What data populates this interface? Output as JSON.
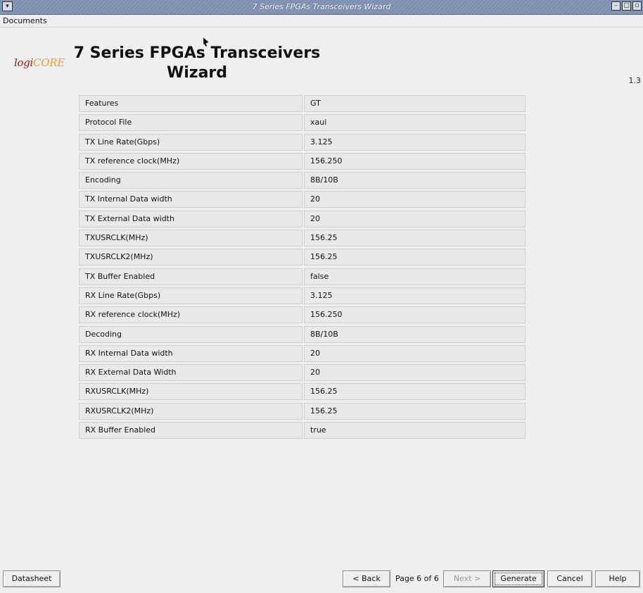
{
  "window": {
    "title": "7 Series FPGAs Transceivers Wizard",
    "menu": [
      "Documents"
    ]
  },
  "header": {
    "logo": {
      "text_prefix": "logi",
      "text_core": "CORE"
    },
    "title": "7 Series FPGAs Transceivers Wizard",
    "version": "1.3"
  },
  "summary_table": [
    {
      "label": "Features",
      "value": "GT"
    },
    {
      "label": "Protocol File",
      "value": "xaui"
    },
    {
      "label": "TX Line Rate(Gbps)",
      "value": "3.125"
    },
    {
      "label": "TX reference clock(MHz)",
      "value": "156.250"
    },
    {
      "label": "Encoding",
      "value": "8B/10B"
    },
    {
      "label": "TX Internal Data width",
      "value": "20"
    },
    {
      "label": "TX External Data width",
      "value": "20"
    },
    {
      "label": "TXUSRCLK(MHz)",
      "value": "156.25"
    },
    {
      "label": "TXUSRCLK2(MHz)",
      "value": "156.25"
    },
    {
      "label": "TX Buffer Enabled",
      "value": "false"
    },
    {
      "label": "RX Line Rate(Gbps)",
      "value": "3.125"
    },
    {
      "label": "RX reference clock(MHz)",
      "value": "156.250"
    },
    {
      "label": "Decoding",
      "value": "8B/10B"
    },
    {
      "label": "RX Internal Data width",
      "value": "20"
    },
    {
      "label": "RX External Data Width",
      "value": "20"
    },
    {
      "label": "RXUSRCLK(MHz)",
      "value": "156.25"
    },
    {
      "label": "RXUSRCLK2(MHz)",
      "value": "156.25"
    },
    {
      "label": "RX Buffer Enabled",
      "value": "true"
    }
  ],
  "footer": {
    "datasheet": "Datasheet",
    "back": "< Back",
    "page_indicator": "Page 6 of 6",
    "next": "Next >",
    "generate": "Generate",
    "cancel": "Cancel",
    "help": "Help"
  },
  "icons": {
    "system_menu": "chevron-down-icon",
    "minimize": "minimize-icon",
    "maximize": "maximize-icon",
    "close": "close-icon"
  },
  "colors": {
    "titlebar": "#7d8dac",
    "logo_red": "#8b1a1a",
    "logo_gold": "#e2a12a"
  }
}
